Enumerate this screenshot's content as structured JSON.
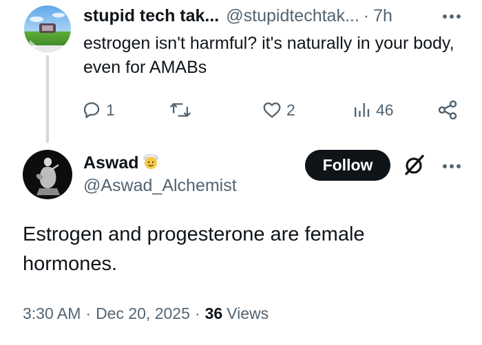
{
  "reply": {
    "display_name": "stupid tech tak...",
    "handle": "@stupidtechtak...",
    "separator": "·",
    "time": "7h",
    "text": "estrogen isn't harmful? it's naturally in your body, even for AMABs",
    "actions": {
      "replies": "1",
      "reposts": "",
      "likes": "2",
      "views": "46"
    }
  },
  "tweet": {
    "display_name": "Aswad",
    "handle": "@Aswad_Alchemist",
    "follow_label": "Follow",
    "text": "Estrogen and progesterone are female hormones.",
    "time": "3:30 AM",
    "separator": "·",
    "date": "Dec 20, 2025",
    "views_count": "36",
    "views_label": "Views"
  },
  "icons": {
    "reply": "reply-icon",
    "repost": "repost-icon",
    "like": "heart-icon",
    "views": "bar-chart-icon",
    "share": "share-icon",
    "more": "more-horizontal-icon",
    "grok": "grok-icon",
    "badge": "emoji-badge-icon"
  },
  "colors": {
    "text_primary": "#0f1419",
    "text_secondary": "#536471",
    "thread_line": "#cfd9de",
    "follow_bg": "#0f1419",
    "follow_text": "#ffffff"
  }
}
